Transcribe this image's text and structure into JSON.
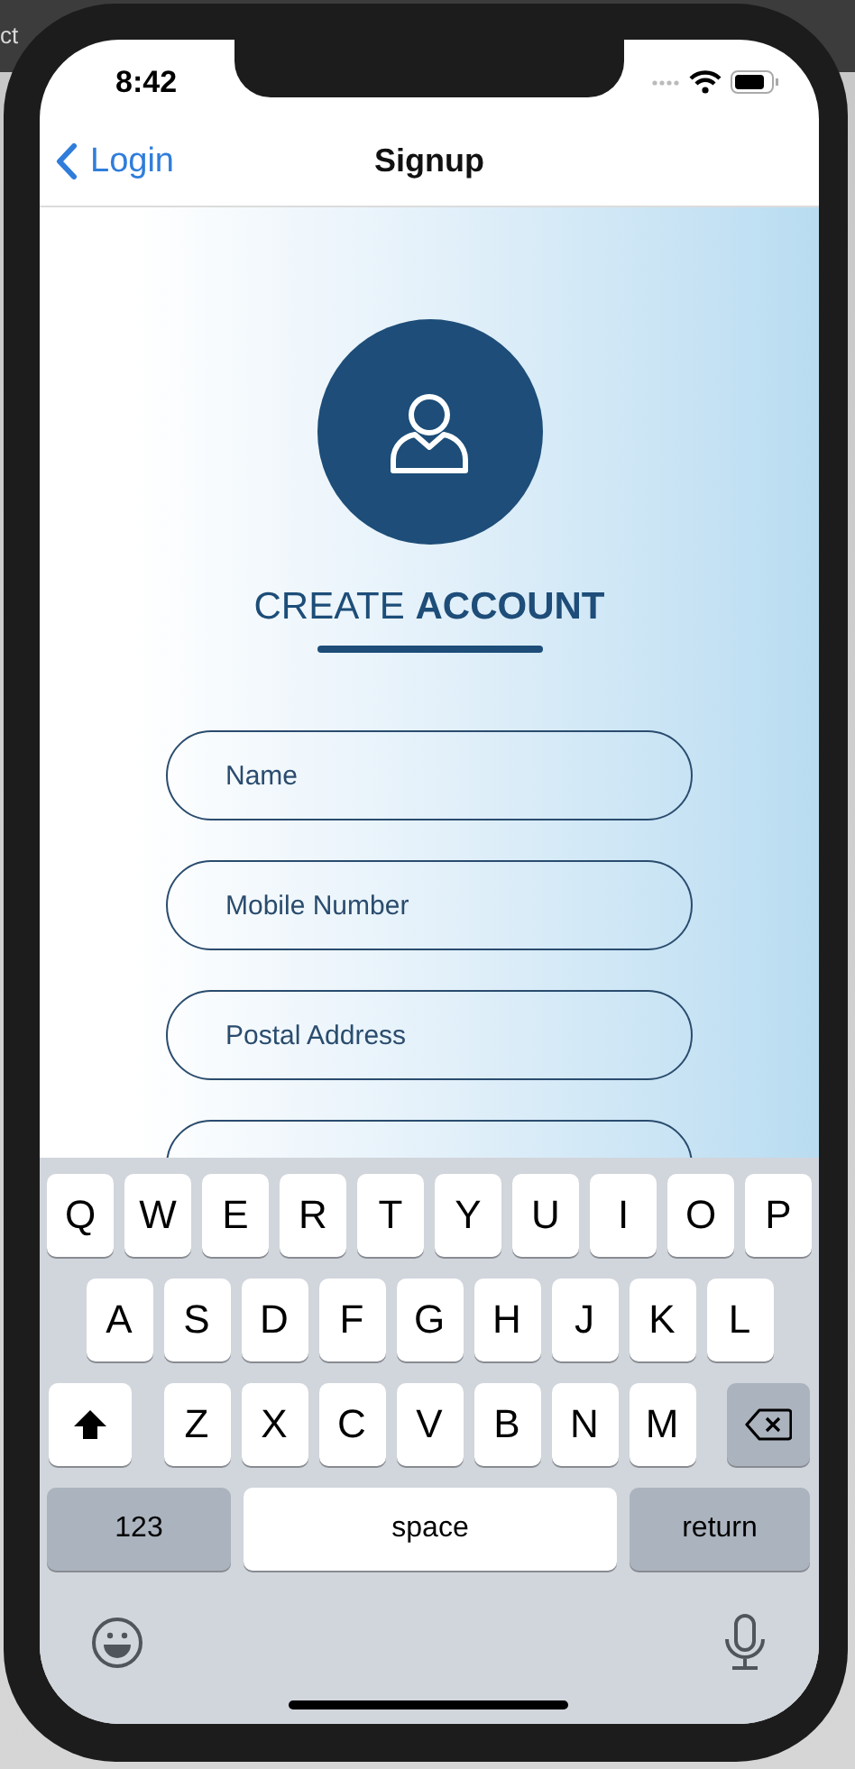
{
  "desktop": {
    "text": "ct"
  },
  "status_bar": {
    "time": "8:42"
  },
  "nav_bar": {
    "back": "Login",
    "title": "Signup"
  },
  "heading": "CREATE **ACCOUNT**",
  "fields": [
    {
      "kind": "input",
      "placeholder": "Name"
    },
    {
      "kind": "input",
      "placeholder": "Mobile Number"
    },
    {
      "kind": "input",
      "placeholder": "Postal Address"
    },
    {
      "kind": "input"
    }
  ],
  "keyboard": {
    "shift_on": true,
    "rows": [
      {
        "kind": "letters",
        "keys": [
          "Q",
          "W",
          "E",
          "R",
          "T",
          "Y",
          "U",
          "I",
          "O",
          "P"
        ]
      },
      {
        "kind": "letters",
        "keys": [
          "A",
          "S",
          "D",
          "F",
          "G",
          "H",
          "J",
          "K",
          "L"
        ]
      },
      {
        "kind": "modifiers",
        "keys": [
          "Z",
          "X",
          "C",
          "V",
          "B",
          "N",
          "M"
        ]
      },
      {
        "kind": "bottom",
        "keys": [
          "123",
          "space",
          "return"
        ]
      }
    ]
  }
}
